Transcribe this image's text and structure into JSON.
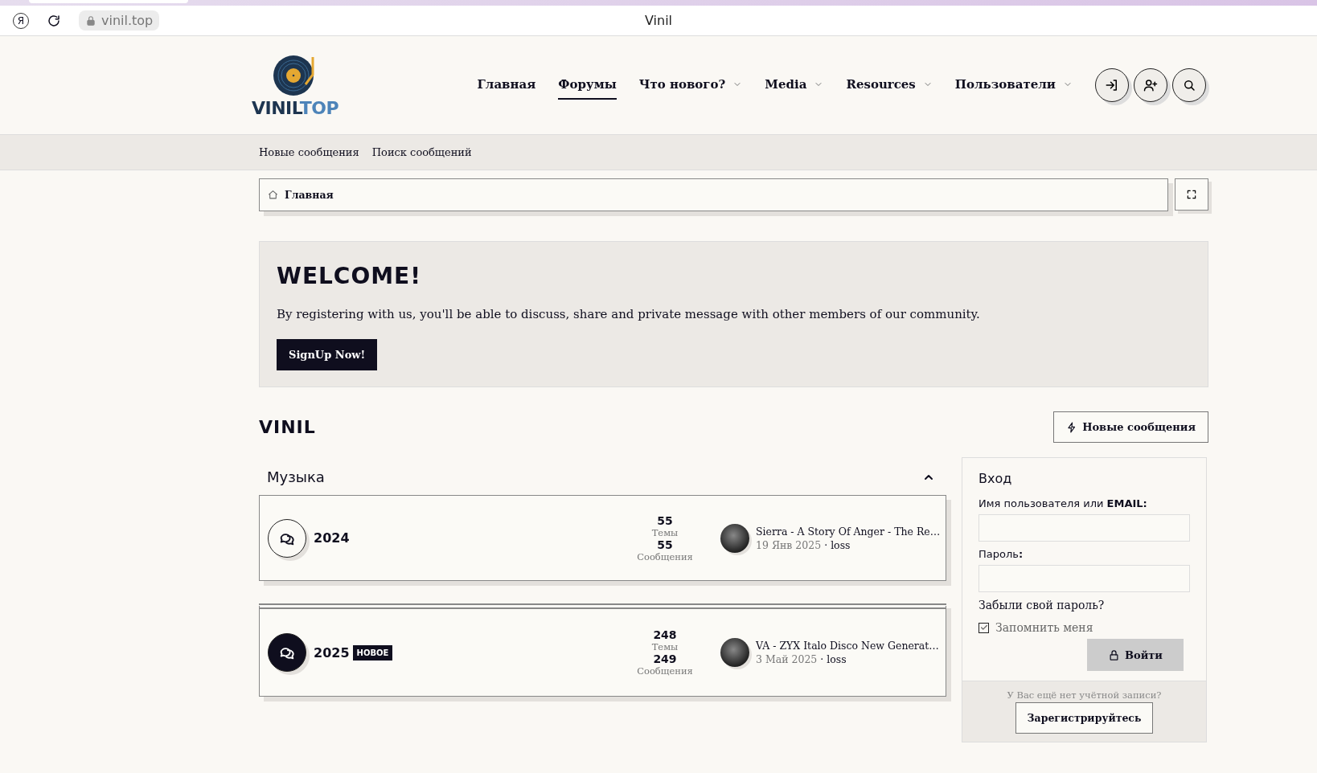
{
  "browser": {
    "profile_glyph": "Я",
    "url": "vinil.top",
    "title": "Vinil"
  },
  "header": {
    "logo_dark": "VINIL",
    "logo_light": "TOP",
    "nav": [
      {
        "label": "Главная",
        "selected": false,
        "dropdown": false
      },
      {
        "label": "Форумы",
        "selected": true,
        "dropdown": false
      },
      {
        "label": "Что нового?",
        "selected": false,
        "dropdown": true
      },
      {
        "label": "Media",
        "selected": false,
        "dropdown": true
      },
      {
        "label": "Resources",
        "selected": false,
        "dropdown": true
      },
      {
        "label": "Пользователи",
        "selected": false,
        "dropdown": true
      }
    ],
    "actions": [
      {
        "kind": "login"
      },
      {
        "kind": "register"
      },
      {
        "kind": "search"
      }
    ]
  },
  "subnav": [
    "Новые сообщения",
    "Поиск сообщений"
  ],
  "breadcrumb": [
    "Главная"
  ],
  "welcome": {
    "title": "WELCOME!",
    "text": "By registering with us, you'll be able to discuss, share and private message with other members of our community.",
    "button": "SignUp Now!"
  },
  "forum": {
    "title": "VINIL",
    "new_posts_button": "Новые сообщения",
    "category": {
      "title": "Музыка",
      "expanded": true
    },
    "nodes": [
      {
        "title": "2024",
        "unread": false,
        "threads": "55",
        "threads_label": "Темы",
        "messages": "55",
        "messages_label": "Сообщения",
        "last_title": "Sierra - A Story Of Anger - The Re…",
        "last_date": "19 Янв 2025",
        "separator": "·",
        "last_user": "loss"
      },
      {
        "title": "2025",
        "unread": true,
        "badge": "НОВОЕ",
        "threads": "248",
        "threads_label": "Темы",
        "messages": "249",
        "messages_label": "Сообщения",
        "last_title": "VA - ZYX Italo Disco New Generat…",
        "last_date": "3 Май 2025",
        "separator": "·",
        "last_user": "loss"
      }
    ]
  },
  "login": {
    "title": "Вход",
    "username_label": "Имя пользователя или **EMAIL:**",
    "password_label": "Пароль**:**",
    "forgot": "Забыли свой пароль?",
    "remember": {
      "label": "Запомнить меня",
      "checked": true
    },
    "submit": "Войти",
    "no_account": "У Вас ещё нет учётной записи?",
    "register": "Зарегистрируйтесь"
  }
}
